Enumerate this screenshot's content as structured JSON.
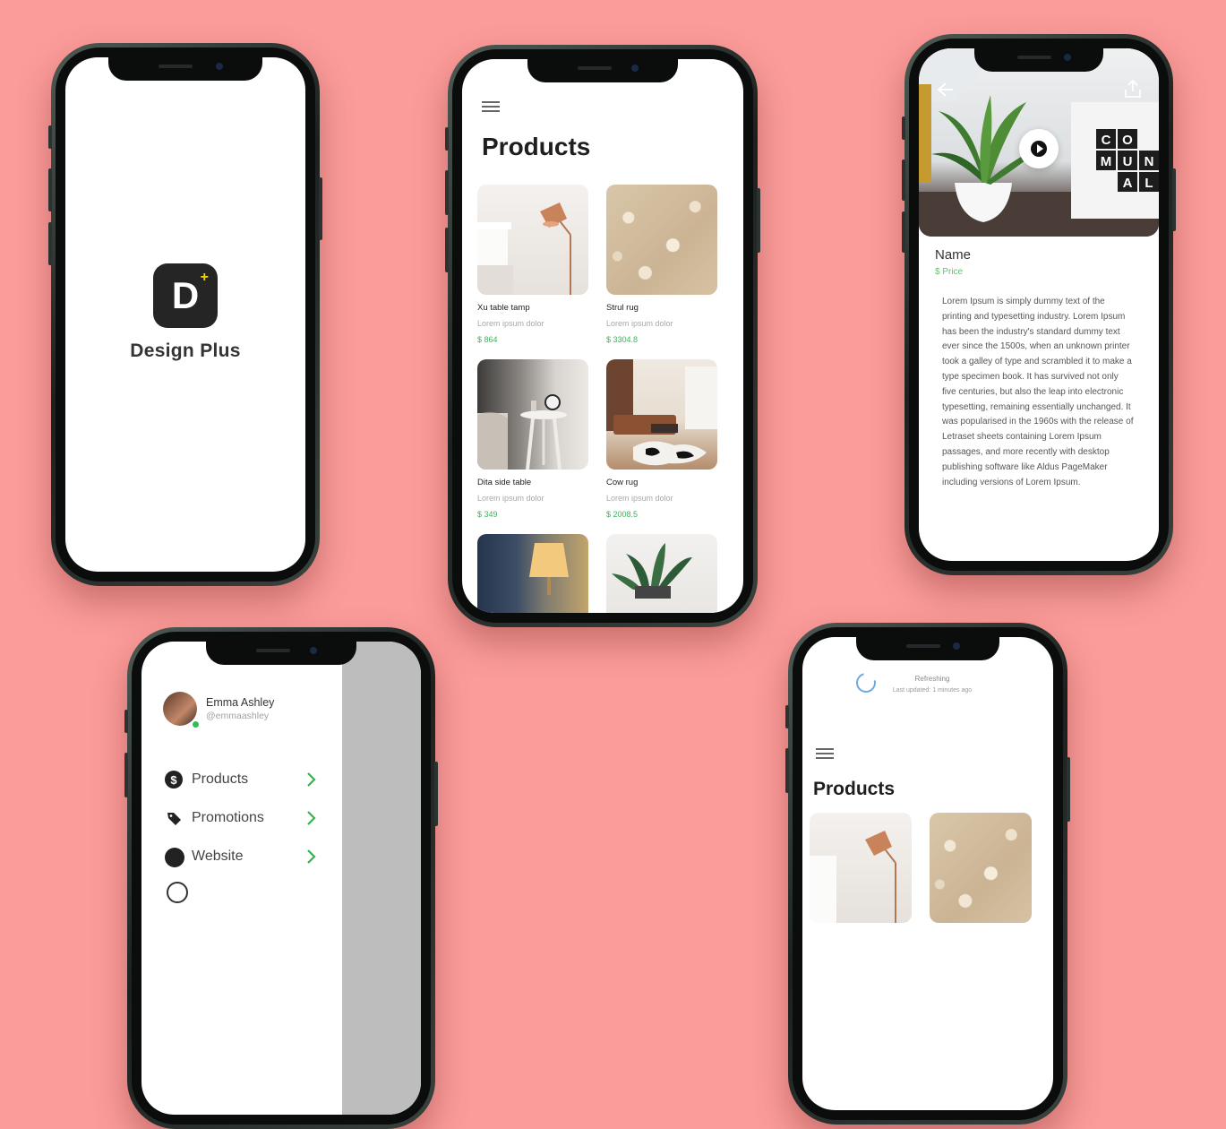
{
  "splash": {
    "logo_letter": "D",
    "logo_plus": "+",
    "app_name": "Design Plus"
  },
  "products_screen": {
    "title": "Products",
    "items": [
      {
        "name": "Xu table tamp",
        "desc": "Lorem ipsum dolor",
        "price": "$ 864",
        "image": "copper-lamp"
      },
      {
        "name": "Strul rug",
        "desc": "Lorem ipsum dolor",
        "price": "$ 3304.8",
        "image": "fluffy-rug"
      },
      {
        "name": "Dita side table",
        "desc": "Lorem ipsum dolor",
        "price": "$ 349",
        "image": "side-table-clock"
      },
      {
        "name": "Cow rug",
        "desc": "Lorem ipsum dolor",
        "price": "$ 2008.5",
        "image": "living-room-rug"
      }
    ],
    "partial_items": [
      "table-lamp",
      "potted-plant"
    ]
  },
  "detail_screen": {
    "name": "Name",
    "price": "$ Price",
    "sign_letters": [
      "C",
      "O",
      "M",
      "U",
      "N",
      "A",
      "L"
    ],
    "description": "Lorem Ipsum is simply dummy text of the printing and typesetting industry. Lorem Ipsum has been the industry's standard dummy text ever since the 1500s, when an unknown printer took a galley of type and scrambled it to make a type specimen book. It has survived not only five centuries, but also the leap into electronic typesetting, remaining essentially unchanged. It was popularised in the 1960s with the release of Letraset sheets containing Lorem Ipsum passages, and more recently with desktop publishing software like Aldus PageMaker including versions of Lorem Ipsum."
  },
  "drawer_screen": {
    "user_name": "Emma Ashley",
    "user_handle": "@emmaashley",
    "menu": [
      {
        "label": "Products",
        "icon": "dollar-icon"
      },
      {
        "label": "Promotions",
        "icon": "tag-icon"
      },
      {
        "label": "Website",
        "icon": "globe-icon"
      }
    ]
  },
  "refresh_screen": {
    "status": "Refreshing",
    "last_updated": "Last updated: 1 minutes ago",
    "title": "Products"
  },
  "colors": {
    "background": "#fb9c9a",
    "price_green": "#3cb25d",
    "logo_accent": "#f3d21c"
  }
}
